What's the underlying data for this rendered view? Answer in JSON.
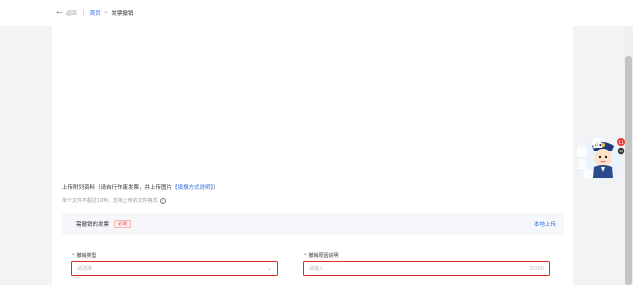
{
  "breadcrumb": {
    "back_label": "返回",
    "home_label": "首页",
    "separator": ">",
    "current_label": "发票撤销"
  },
  "upload": {
    "instruction_prefix": "上传附列资料（请自行作废发票，并上传图片",
    "instruction_link": "【填报方式说明】",
    "instruction_suffix": "）",
    "hint": "单个文件不超过10M，支持上传的文件格式"
  },
  "invoice_section": {
    "title": "需撤销的发票",
    "required_tag": "必填",
    "upload_local": "本地上传"
  },
  "form": {
    "revoke_type": {
      "required_mark": "*",
      "label": "撤销类型",
      "placeholder": "请选择"
    },
    "revoke_reason": {
      "required_mark": "*",
      "label": "撤销原因说明",
      "placeholder": "请输入",
      "counter": "0/100"
    }
  },
  "mascot": {
    "text_chars": [
      "征",
      "纳",
      "互",
      "动"
    ],
    "badge_count": "11"
  },
  "colors": {
    "link": "#2b6de5",
    "error_border": "#e22a2a",
    "required": "#e04a4a",
    "mascot_text": "#2d7fe0",
    "page_bg": "#f2f3f5"
  }
}
